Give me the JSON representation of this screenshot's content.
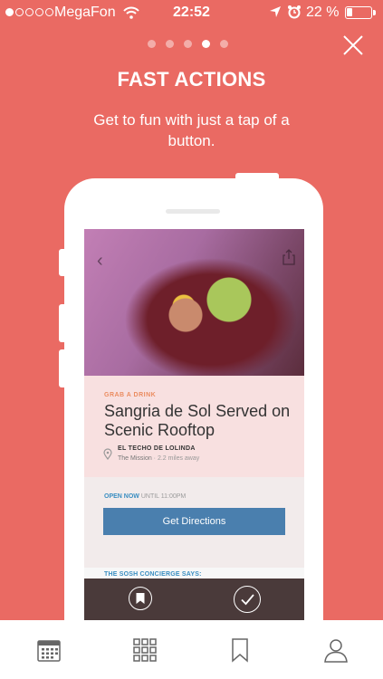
{
  "status_bar": {
    "carrier": "MegaFon",
    "time": "22:52",
    "battery_percent_text": "22 %",
    "battery_level": 0.22,
    "signal_bars": 1
  },
  "onboarding": {
    "page_count": 5,
    "active_page": 4,
    "heading": "FAST ACTIONS",
    "subtitle": "Get to fun with just a tap of a button."
  },
  "card": {
    "eyebrow": "GRAB A DRINK",
    "title": "Sangria de Sol Served on Scenic Rooftop",
    "venue": "EL TECHO DE LOLINDA",
    "neighborhood": "The Mission",
    "distance": " · 2.2 miles away",
    "open_status": "OPEN NOW",
    "open_until": "UNTIL 11:00PM",
    "directions_label": "Get Directions",
    "concierge_label": "THE SOSH CONCIERGE SAYS:"
  },
  "tabs": [
    {
      "icon": "calendar-icon"
    },
    {
      "icon": "grid-icon"
    },
    {
      "icon": "bookmark-icon"
    },
    {
      "icon": "profile-icon"
    }
  ],
  "colors": {
    "background": "#ea6a63",
    "accent_blue": "#4a7fae",
    "eyebrow_orange": "#eb8c60"
  }
}
